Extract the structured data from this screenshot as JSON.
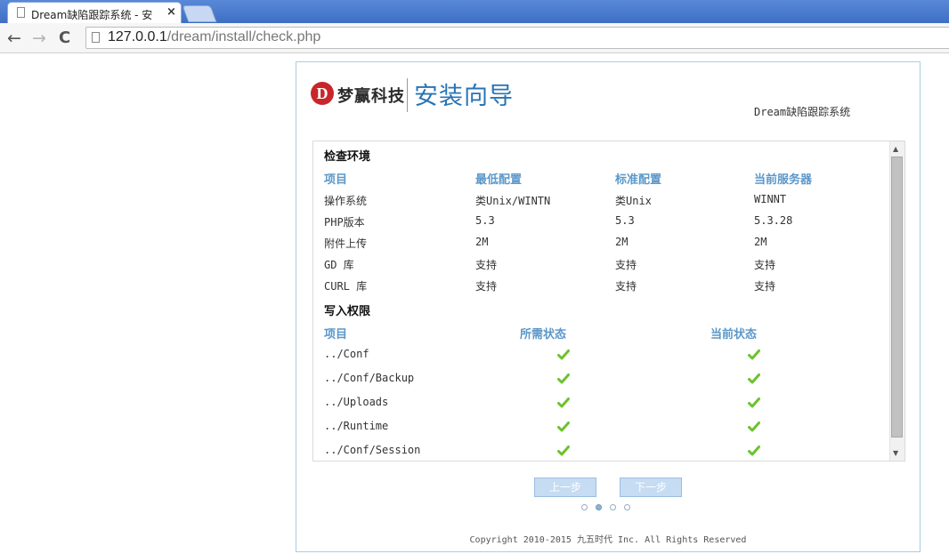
{
  "browser": {
    "tab_title": "Dream缺陷跟踪系统 - 安",
    "tab_close": "×",
    "nav_back": "←",
    "nav_forward": "→",
    "nav_reload": "C",
    "url_host": "127.0.0.1",
    "url_path": "/dream/install/check.php"
  },
  "header": {
    "logo_mark": "D",
    "logo_text": "梦赢科技",
    "wizard_title": "安装向导",
    "system_name": "Dream缺陷跟踪系统"
  },
  "env": {
    "title": "检查环境",
    "columns": [
      "项目",
      "最低配置",
      "标准配置",
      "当前服务器"
    ],
    "rows": [
      [
        "操作系统",
        "类Unix/WINTN",
        "类Unix",
        "WINNT"
      ],
      [
        "PHP版本",
        "5.3",
        "5.3",
        "5.3.28"
      ],
      [
        "附件上传",
        "2M",
        "2M",
        "2M"
      ],
      [
        "GD 库",
        "支持",
        "支持",
        "支持"
      ],
      [
        "CURL 库",
        "支持",
        "支持",
        "支持"
      ]
    ]
  },
  "perm": {
    "title": "写入权限",
    "columns": [
      "项目",
      "所需状态",
      "当前状态"
    ],
    "rows": [
      {
        "path": "../Conf"
      },
      {
        "path": "../Conf/Backup"
      },
      {
        "path": "../Uploads"
      },
      {
        "path": "../Runtime"
      },
      {
        "path": "../Conf/Session"
      }
    ]
  },
  "scrollbar": {
    "up": "▲",
    "down": "▼"
  },
  "footer": {
    "prev_label": "上一步",
    "next_label": "下一步",
    "steps_total": 4,
    "step_current": 2,
    "copyright": "Copyright 2010-2015 九五时代 Inc. All Rights Reserved"
  },
  "colors": {
    "accent": "#2874b5",
    "header_col": "#5b97c9",
    "check": "#6cc22c"
  }
}
